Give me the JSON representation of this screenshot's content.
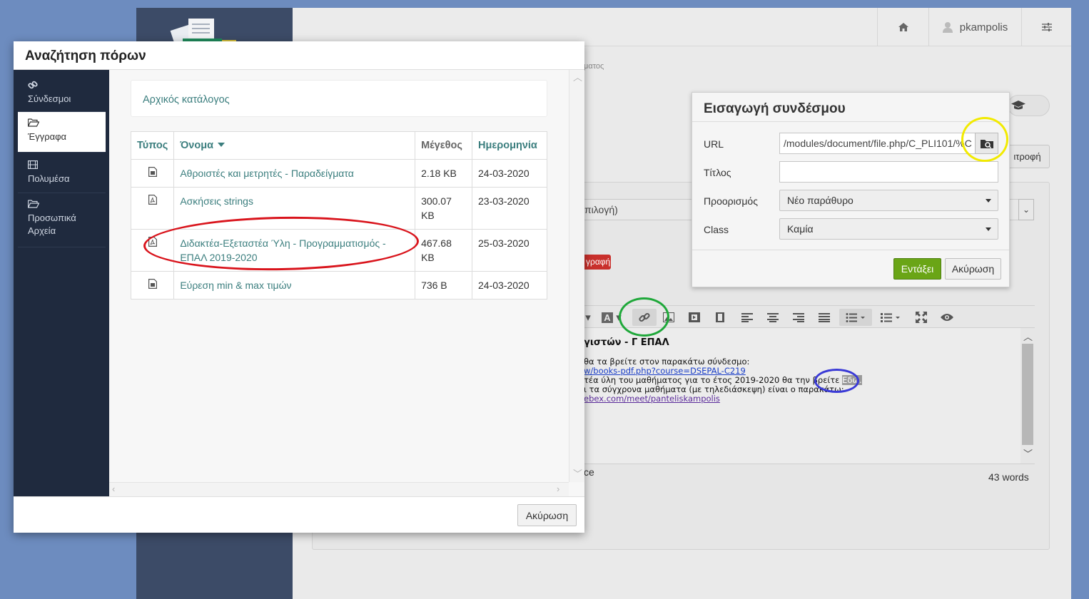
{
  "app": {
    "username": "pkampolis",
    "crumb_fragment": "ματος",
    "return_button_partial": "ιτροφή",
    "select_partial": "πιλογή)",
    "red_button_partial": "γραφή"
  },
  "editor": {
    "heading": "γιστών - Γ ΕΠΑΛ",
    "line1": "θα τα βρείτε στον παρακάτω σύνδεσμο:",
    "link1": "w/books-pdf.php?course=DSEPAL-C219",
    "line2_pre": "τέα ύλη του μαθήματος για το έτος 2019-2020 θα την βρείτε ",
    "line2_sel": "Εδώ.",
    "line3": "ι τα σύγχρονα μαθήματα (με τηλεδιάσκεψη) είναι ο παρακάτω:",
    "link2": "ebex.com/meet/panteliskampolis",
    "status_partial": "ce",
    "word_count": "43 words"
  },
  "link_dialog": {
    "title": "Εισαγωγή συνδέσμου",
    "url_label": "URL",
    "url_value": "/modules/document/file.php/C_PLI101/%C",
    "title_label": "Τίτλος",
    "title_value": "",
    "target_label": "Προορισμός",
    "target_value": "Νέο παράθυρο",
    "class_label": "Class",
    "class_value": "Καμία",
    "insert_label": "Εντάξει",
    "cancel_label": "Ακύρωση"
  },
  "resource_modal": {
    "title": "Αναζήτηση πόρων",
    "nav": [
      {
        "label": "Σύνδεσμοι",
        "icon": "link-icon"
      },
      {
        "label": "Έγγραφα",
        "icon": "folder-open-icon"
      },
      {
        "label": "Πολυμέσα",
        "icon": "film-icon"
      },
      {
        "label": "Προσωπικά Αρχεία",
        "icon": "folder-open-icon"
      }
    ],
    "root_label": "Αρχικός κατάλογος",
    "columns": {
      "type": "Τύπος",
      "name": "Όνομα",
      "size": "Μέγεθος",
      "date": "Ημερομηνία"
    },
    "files": [
      {
        "icon": "file-icon",
        "name": "Αθροιστές και μετρητές - Παραδείγματα",
        "size": "2.18 KB",
        "date": "24-03-2020"
      },
      {
        "icon": "pdf-file-icon",
        "name": "Ασκήσεις strings",
        "size": "300.07 KB",
        "date": "23-03-2020"
      },
      {
        "icon": "pdf-file-icon",
        "name": "Διδακτέα-Εξεταστέα Ύλη - Προγραμματισμός - ΕΠΑΛ 2019-2020",
        "size": "467.68 KB",
        "date": "25-03-2020"
      },
      {
        "icon": "file-icon",
        "name": "Εύρεση min & max τιμών",
        "size": "736 B",
        "date": "24-03-2020"
      }
    ],
    "cancel_label": "Ακύρωση"
  },
  "colors": {
    "annotation_red": "#d9141c",
    "annotation_yellow": "#f2ea00",
    "annotation_green": "#1fa83a",
    "annotation_blue": "#3a3ad6",
    "accent_teal": "#3b7e7e",
    "ok_green": "#6aa516"
  }
}
